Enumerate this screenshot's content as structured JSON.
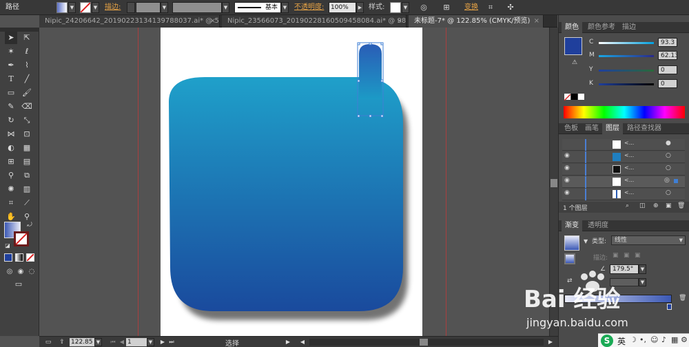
{
  "controlbar": {
    "title": "路径",
    "stroke_label": "描边:",
    "stroke_profile": "基本",
    "opacity_label": "不透明度:",
    "opacity_value": "100%",
    "style_label": "样式:",
    "transform_label": "变换"
  },
  "tabs": [
    {
      "label": "Nipic_24206642_20190223134139788037.ai* @ 50..."
    },
    {
      "label": "Nipic_23566073_20190228160509458084.ai* @ 98..."
    },
    {
      "label": "未标题-7* @ 122.85% (CMYK/预览)"
    }
  ],
  "statusbar": {
    "zoom": "122.85",
    "page": "1",
    "tool_name": "选择"
  },
  "color_panel": {
    "tabs": [
      "颜色",
      "颜色参考",
      "描边"
    ],
    "channels": [
      {
        "label": "C",
        "value": "93.3"
      },
      {
        "label": "M",
        "value": "62.13"
      },
      {
        "label": "Y",
        "value": "0"
      },
      {
        "label": "K",
        "value": "0"
      }
    ]
  },
  "layers_panel": {
    "tabs": [
      "色板",
      "画笔",
      "图层",
      "路径查找器"
    ],
    "footer": "1 个图层"
  },
  "gradient_panel": {
    "tabs": [
      "渐变",
      "透明度"
    ],
    "type_label": "类型:",
    "type_value": "线性",
    "stroke_label": "描边:",
    "angle_value": "179.5°"
  },
  "watermark": {
    "brand": "Bai 经验",
    "url": "jingyan.baidu.com"
  },
  "taskbar": {
    "ime": "英"
  },
  "colors": {
    "fill_top": "#1f9ec9",
    "fill_bottom": "#1b4a9c",
    "selection": "#3f7fd4",
    "guide": "#c23a3a",
    "accent": "#e8a446"
  }
}
